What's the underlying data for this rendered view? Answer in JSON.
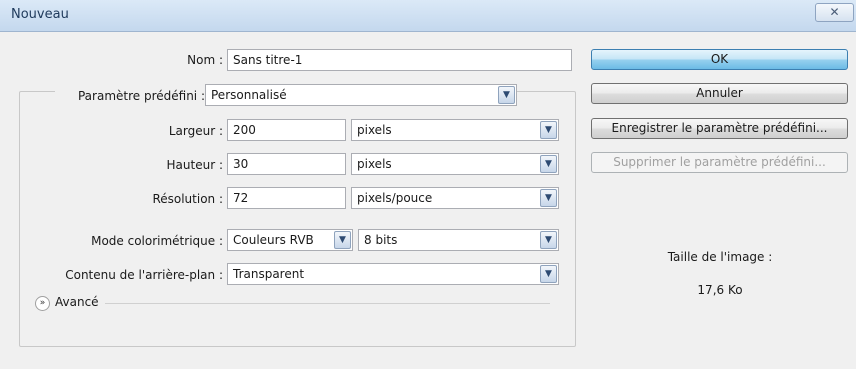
{
  "window": {
    "title": "Nouveau",
    "close_glyph": "✕"
  },
  "form": {
    "name": {
      "label": "Nom :",
      "value": "Sans titre-1"
    },
    "preset": {
      "label": "Paramètre prédéfini :",
      "value": "Personnalisé"
    },
    "width": {
      "label": "Largeur :",
      "value": "200",
      "unit": "pixels"
    },
    "height": {
      "label": "Hauteur :",
      "value": "30",
      "unit": "pixels"
    },
    "resolution": {
      "label": "Résolution :",
      "value": "72",
      "unit": "pixels/pouce"
    },
    "color_mode": {
      "label": "Mode colorimétrique :",
      "value": "Couleurs RVB",
      "depth": "8 bits"
    },
    "background": {
      "label": "Contenu de l'arrière-plan :",
      "value": "Transparent"
    },
    "advanced": {
      "label": "Avancé",
      "icon": "double-chevron-down-icon"
    }
  },
  "buttons": {
    "ok": "OK",
    "cancel": "Annuler",
    "save_preset": "Enregistrer le paramètre prédéfini...",
    "delete_preset": "Supprimer le paramètre prédéfini..."
  },
  "image_size": {
    "label": "Taille de l'image :",
    "value": "17,6 Ko"
  },
  "colors": {
    "titlebar": "#c4d8ee",
    "default_button": "#98d1ef",
    "background": "#f0f0f0"
  }
}
